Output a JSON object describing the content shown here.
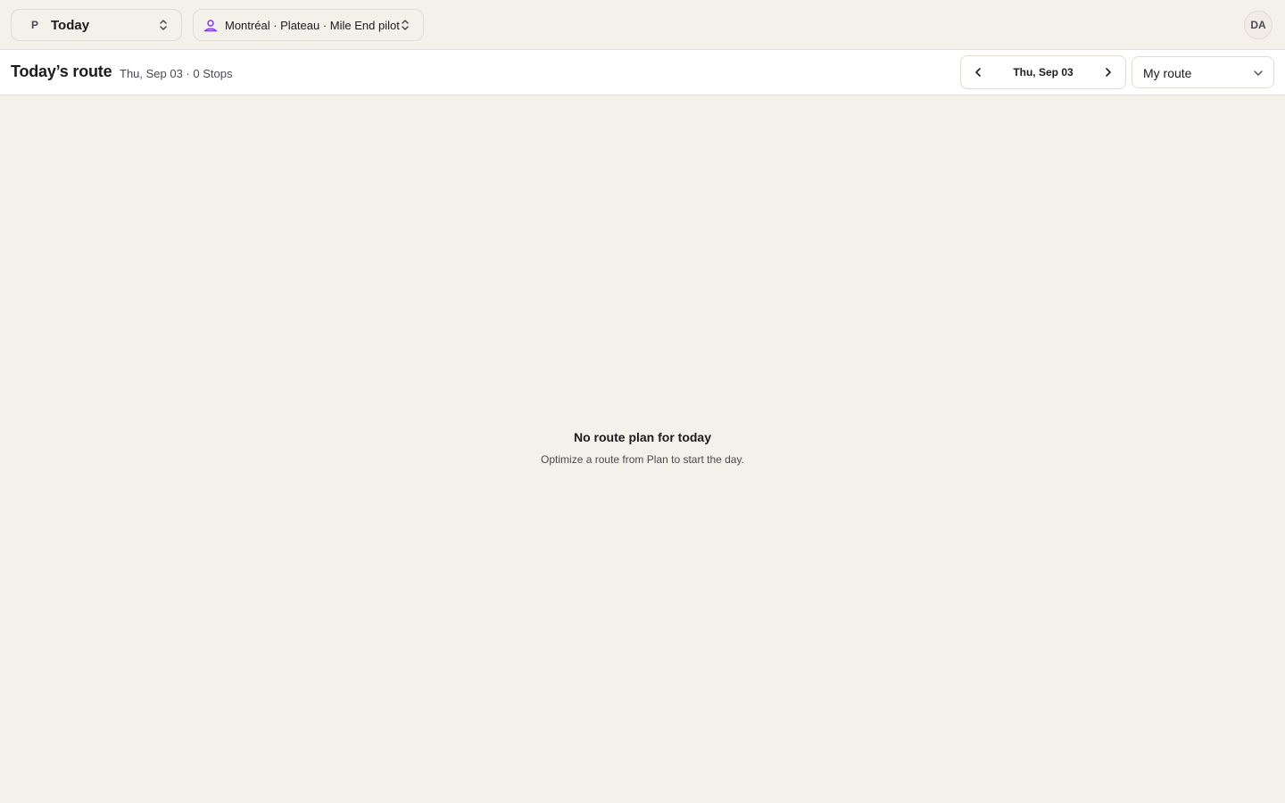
{
  "topbar": {
    "workspace": {
      "letter": "P",
      "name": "Today"
    },
    "region": {
      "name": "Montréal · Plateau · Mile End pilot",
      "icon": "user-location-icon",
      "icon_color": "#7c3aed"
    },
    "avatar": {
      "initials": "DA"
    }
  },
  "subheader": {
    "title": "Today’s route",
    "meta": "Thu, Sep 03 · 0 Stops",
    "date_nav": {
      "label": "Thu, Sep 03",
      "prev_icon": "chevron-left-icon",
      "next_icon": "chevron-right-icon"
    },
    "route_select": {
      "selected": "My route"
    }
  },
  "empty_state": {
    "title": "No route plan for today",
    "subtitle": "Optimize a route from Plan to start the day."
  },
  "colors": {
    "background": "#f4f0ea",
    "surface": "#ffffff",
    "border": "#e0dbd3",
    "accent": "#7c3aed"
  }
}
